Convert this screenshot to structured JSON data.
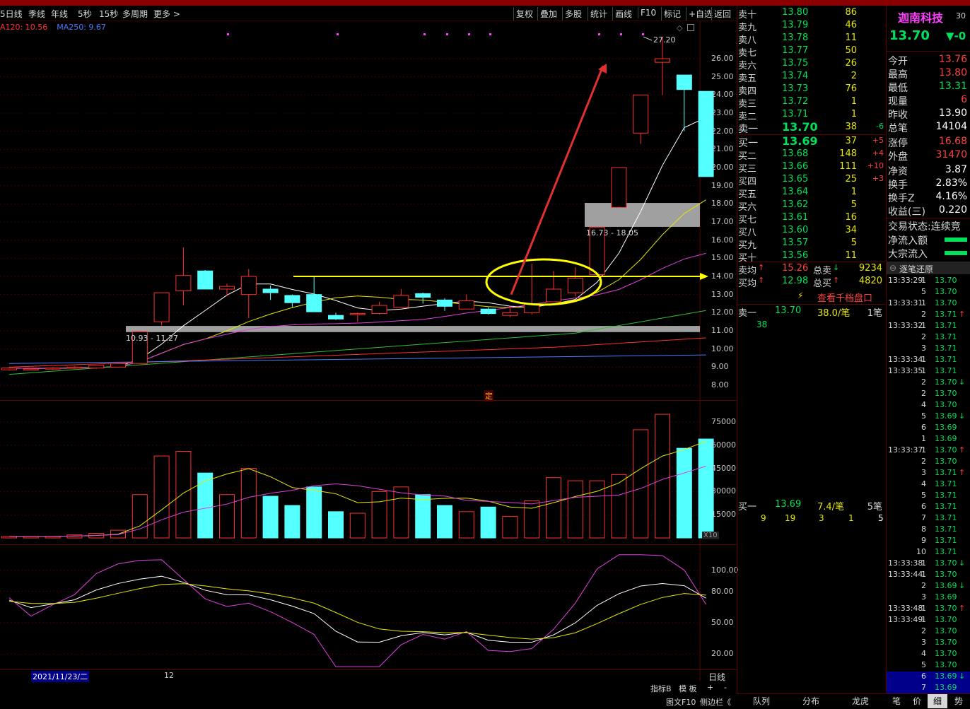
{
  "toolbar": {
    "left_items": [
      "5日线",
      "季线",
      "年线",
      "5秒",
      "15秒",
      "多周期",
      "更多 >"
    ],
    "right_items": [
      "复权",
      "叠加",
      "多股",
      "统计",
      "画线",
      "F10",
      "标记",
      "+自选",
      "返回"
    ]
  },
  "ma_legend": [
    {
      "text": "A120: 10.56",
      "color": "#ff3030"
    },
    {
      "text": "MA250: 9.67",
      "color": "#4a7bff"
    }
  ],
  "price_axis": [
    "26.00",
    "25.00",
    "24.00",
    "23.00",
    "22.00",
    "21.00",
    "20.00",
    "19.00",
    "18.00",
    "17.00",
    "16.00",
    "15.00",
    "14.00",
    "13.00",
    "12.00",
    "11.00",
    "10.00",
    "9.00",
    "8.00"
  ],
  "volume_axis": [
    "75000",
    "60000",
    "45000",
    "30000",
    "15000"
  ],
  "volume_unit": "X10",
  "kdj_axis": [
    "100.00",
    "80.00",
    "50.00",
    "20.00"
  ],
  "annotations": {
    "high_label": "27.20",
    "zone_low_label": "10.93 - 11.27",
    "zone_high_label": "16.73 - 18.05",
    "marker": "定"
  },
  "date_bar": {
    "date": "2021/11/23/二",
    "month": "12",
    "period": "日线"
  },
  "indicator_bar": {
    "items": [
      "指标B",
      "模 板",
      "+",
      "-"
    ]
  },
  "bottom_bar": {
    "items": [
      "图文F10",
      "侧边栏《"
    ]
  },
  "candles": [
    {
      "o": 8.85,
      "c": 8.95,
      "h": 9.0,
      "l": 8.8
    },
    {
      "o": 8.9,
      "c": 8.9,
      "h": 8.95,
      "l": 8.85
    },
    {
      "o": 8.9,
      "c": 8.95,
      "h": 9.0,
      "l": 8.85
    },
    {
      "o": 8.95,
      "c": 9.0,
      "h": 9.05,
      "l": 8.9
    },
    {
      "o": 8.95,
      "c": 9.1,
      "h": 9.1,
      "l": 8.9
    },
    {
      "o": 9.0,
      "c": 9.2,
      "h": 9.2,
      "l": 9.0
    },
    {
      "o": 9.2,
      "c": 10.95,
      "h": 10.95,
      "l": 9.2
    },
    {
      "o": 11.5,
      "c": 13.1,
      "h": 13.1,
      "l": 11.3
    },
    {
      "o": 13.2,
      "c": 14.05,
      "h": 15.6,
      "l": 12.4
    },
    {
      "o": 14.3,
      "c": 13.3,
      "h": 14.35,
      "l": 13.3
    },
    {
      "o": 13.3,
      "c": 13.45,
      "h": 13.6,
      "l": 12.9
    },
    {
      "o": 13.0,
      "c": 14.0,
      "h": 14.4,
      "l": 11.7
    },
    {
      "o": 13.3,
      "c": 13.1,
      "h": 13.5,
      "l": 12.7
    },
    {
      "o": 12.95,
      "c": 12.55,
      "h": 13.0,
      "l": 12.3
    },
    {
      "o": 13.0,
      "c": 12.05,
      "h": 14.0,
      "l": 12.05
    },
    {
      "o": 11.85,
      "c": 11.65,
      "h": 12.0,
      "l": 11.6
    },
    {
      "o": 11.95,
      "c": 11.95,
      "h": 12.0,
      "l": 11.5
    },
    {
      "o": 11.95,
      "c": 12.4,
      "h": 12.6,
      "l": 11.9
    },
    {
      "o": 12.3,
      "c": 12.95,
      "h": 13.3,
      "l": 12.3
    },
    {
      "o": 13.05,
      "c": 12.85,
      "h": 13.1,
      "l": 12.5
    },
    {
      "o": 12.7,
      "c": 12.35,
      "h": 12.8,
      "l": 12.1
    },
    {
      "o": 12.2,
      "c": 12.65,
      "h": 13.0,
      "l": 12.2
    },
    {
      "o": 12.2,
      "c": 11.95,
      "h": 12.3,
      "l": 11.9
    },
    {
      "o": 11.85,
      "c": 12.0,
      "h": 12.35,
      "l": 11.75
    },
    {
      "o": 12.0,
      "c": 12.5,
      "h": 14.7,
      "l": 11.9
    },
    {
      "o": 12.6,
      "c": 13.3,
      "h": 14.3,
      "l": 12.6
    },
    {
      "o": 13.1,
      "c": 13.9,
      "h": 14.5,
      "l": 12.9
    },
    {
      "o": 14.1,
      "c": 16.7,
      "h": 16.7,
      "l": 14.1
    },
    {
      "o": 17.8,
      "c": 20.0,
      "h": 20.0,
      "l": 17.8
    },
    {
      "o": 21.9,
      "c": 24.0,
      "h": 24.0,
      "l": 21.3
    },
    {
      "o": 25.8,
      "c": 26.0,
      "h": 27.2,
      "l": 24.0
    },
    {
      "o": 25.1,
      "c": 24.3,
      "h": 25.1,
      "l": 22.0
    },
    {
      "o": 24.2,
      "c": 19.5,
      "h": 24.2,
      "l": 19.5
    }
  ],
  "volumes": [
    1000,
    1000,
    1000,
    2000,
    3000,
    5000,
    28000,
    53000,
    56000,
    42000,
    28000,
    45000,
    27000,
    21000,
    33000,
    17000,
    16000,
    30000,
    33000,
    28000,
    21000,
    17000,
    20000,
    14000,
    24000,
    39000,
    37000,
    37000,
    41000,
    70000,
    80000,
    58000,
    64000
  ],
  "order_book": {
    "sell": [
      {
        "label": "卖十",
        "price": "13.80",
        "vol": "86",
        "chg": ""
      },
      {
        "label": "卖九",
        "price": "13.79",
        "vol": "46",
        "chg": ""
      },
      {
        "label": "卖八",
        "price": "13.78",
        "vol": "11",
        "chg": ""
      },
      {
        "label": "卖七",
        "price": "13.77",
        "vol": "50",
        "chg": ""
      },
      {
        "label": "卖六",
        "price": "13.75",
        "vol": "26",
        "chg": ""
      },
      {
        "label": "卖五",
        "price": "13.74",
        "vol": "2",
        "chg": ""
      },
      {
        "label": "卖四",
        "price": "13.73",
        "vol": "76",
        "chg": ""
      },
      {
        "label": "卖三",
        "price": "13.72",
        "vol": "1",
        "chg": ""
      },
      {
        "label": "卖二",
        "price": "13.71",
        "vol": "1",
        "chg": ""
      },
      {
        "label": "卖一",
        "price": "13.70",
        "vol": "38",
        "chg": "-6"
      }
    ],
    "buy": [
      {
        "label": "买一",
        "price": "13.69",
        "vol": "37",
        "chg": "+5"
      },
      {
        "label": "买二",
        "price": "13.68",
        "vol": "148",
        "chg": "+4"
      },
      {
        "label": "买三",
        "price": "13.66",
        "vol": "111",
        "chg": "+10"
      },
      {
        "label": "买四",
        "price": "13.65",
        "vol": "25",
        "chg": "+3"
      },
      {
        "label": "买五",
        "price": "13.64",
        "vol": "1",
        "chg": ""
      },
      {
        "label": "买六",
        "price": "13.62",
        "vol": "5",
        "chg": ""
      },
      {
        "label": "买七",
        "price": "13.61",
        "vol": "16",
        "chg": ""
      },
      {
        "label": "买八",
        "price": "13.60",
        "vol": "34",
        "chg": ""
      },
      {
        "label": "买九",
        "price": "13.57",
        "vol": "5",
        "chg": ""
      },
      {
        "label": "买十",
        "price": "13.56",
        "vol": "11",
        "chg": ""
      }
    ],
    "avg_sell_label": "卖均",
    "avg_sell": "15.26",
    "total_sell_label": "总卖",
    "total_sell": "9234",
    "avg_buy_label": "买均",
    "avg_buy": "12.98",
    "total_buy_label": "总买",
    "total_buy": "4820",
    "depth_link": "查看千档盘口",
    "sell1_detail": {
      "label": "卖一",
      "price": "13.70",
      "avg": "38.0/笔",
      "count": "1笔",
      "orders": [
        "38"
      ]
    },
    "buy1_detail": {
      "label": "买一",
      "price": "13.69",
      "avg": "7.4/笔",
      "count": "5笔",
      "orders": [
        "9",
        "19",
        "3",
        "1",
        "5"
      ]
    }
  },
  "quote": {
    "name": "迦南科技",
    "code": "30",
    "price": "13.70",
    "change": "▼-0",
    "rows": [
      {
        "label": "今开",
        "value": "13.76",
        "color": "#ff4040"
      },
      {
        "label": "最高",
        "value": "13.80",
        "color": "#ff4040"
      },
      {
        "label": "最低",
        "value": "13.31",
        "color": "#00e05a"
      },
      {
        "label": "现量",
        "value": "6",
        "color": "#ff4040"
      },
      {
        "label": "昨收",
        "value": "13.90",
        "color": "#ffffff"
      },
      {
        "label": "总笔",
        "value": "14104",
        "color": "#ffffff"
      },
      {
        "label": "涨停",
        "value": "16.68",
        "color": "#ff4040"
      },
      {
        "label": "外盘",
        "value": "31470",
        "color": "#ff4040"
      },
      {
        "label": "净资",
        "value": "3.87",
        "color": "#ffffff"
      },
      {
        "label": "换手",
        "value": "2.83%",
        "color": "#ffffff"
      },
      {
        "label": "换手Z",
        "value": "4.16%",
        "color": "#ffffff"
      },
      {
        "label": "收益(三)",
        "value": "0.220",
        "color": "#ffffff"
      }
    ],
    "trade_status_label": "交易状态:",
    "trade_status": "连续竞",
    "net_inflow": "净流入额",
    "block_inflow": "大宗流入",
    "tick_toggle": "逐笔还原"
  },
  "ticks": [
    {
      "t": "13:33:29",
      "v": "1",
      "p": "13.70",
      "d": ""
    },
    {
      "t": "",
      "v": "5",
      "p": "13.70",
      "d": ""
    },
    {
      "t": "13:33:31",
      "v": "1",
      "p": "13.70",
      "d": ""
    },
    {
      "t": "",
      "v": "2",
      "p": "13.71",
      "d": "↑"
    },
    {
      "t": "13:33:32",
      "v": "1",
      "p": "13.71",
      "d": ""
    },
    {
      "t": "",
      "v": "2",
      "p": "13.71",
      "d": ""
    },
    {
      "t": "",
      "v": "3",
      "p": "13.71",
      "d": ""
    },
    {
      "t": "13:33:34",
      "v": "1",
      "p": "13.71",
      "d": ""
    },
    {
      "t": "13:33:35",
      "v": "1",
      "p": "13.71",
      "d": ""
    },
    {
      "t": "",
      "v": "2",
      "p": "13.70",
      "d": "↓"
    },
    {
      "t": "",
      "v": "2",
      "p": "13.70",
      "d": ""
    },
    {
      "t": "",
      "v": "4",
      "p": "13.70",
      "d": ""
    },
    {
      "t": "",
      "v": "5",
      "p": "13.69",
      "d": "↓"
    },
    {
      "t": "",
      "v": "6",
      "p": "13.69",
      "d": ""
    },
    {
      "t": "",
      "v": "1",
      "p": "13.69",
      "d": ""
    },
    {
      "t": "13:33:37",
      "v": "1",
      "p": "13.70",
      "d": "↑"
    },
    {
      "t": "",
      "v": "2",
      "p": "13.70",
      "d": ""
    },
    {
      "t": "",
      "v": "3",
      "p": "13.71",
      "d": "↑"
    },
    {
      "t": "",
      "v": "4",
      "p": "13.71",
      "d": ""
    },
    {
      "t": "",
      "v": "5",
      "p": "13.71",
      "d": ""
    },
    {
      "t": "",
      "v": "6",
      "p": "13.71",
      "d": ""
    },
    {
      "t": "",
      "v": "7",
      "p": "13.71",
      "d": ""
    },
    {
      "t": "",
      "v": "8",
      "p": "13.71",
      "d": ""
    },
    {
      "t": "",
      "v": "9",
      "p": "13.71",
      "d": ""
    },
    {
      "t": "",
      "v": "10",
      "p": "13.71",
      "d": ""
    },
    {
      "t": "13:33:38",
      "v": "1",
      "p": "13.70",
      "d": "↓"
    },
    {
      "t": "13:33:44",
      "v": "1",
      "p": "13.70",
      "d": ""
    },
    {
      "t": "",
      "v": "2",
      "p": "13.69",
      "d": "↓"
    },
    {
      "t": "",
      "v": "3",
      "p": "13.69",
      "d": ""
    },
    {
      "t": "13:33:48",
      "v": "1",
      "p": "13.70",
      "d": "↑"
    },
    {
      "t": "13:33:49",
      "v": "1",
      "p": "13.70",
      "d": ""
    },
    {
      "t": "",
      "v": "2",
      "p": "13.70",
      "d": ""
    },
    {
      "t": "",
      "v": "3",
      "p": "13.70",
      "d": ""
    },
    {
      "t": "",
      "v": "4",
      "p": "13.70",
      "d": ""
    },
    {
      "t": "",
      "v": "5",
      "p": "13.70",
      "d": ""
    },
    {
      "t": "",
      "v": "6",
      "p": "13.69",
      "d": "↓"
    },
    {
      "t": "",
      "v": "7",
      "p": "13.69",
      "d": ""
    }
  ],
  "bottom_tabs": [
    "队列",
    "分布",
    "龙虎",
    "笔",
    "价",
    "细",
    "势"
  ],
  "colors": {
    "up": "#ff3030",
    "down": "#54ffff",
    "price_up": "#ff4040",
    "price_down": "#00e05a",
    "ma5": "#ffffff",
    "ma10": "#e6e600",
    "ma20": "#e040e0",
    "ma60": "#30c030",
    "ma120": "#ff3030",
    "ma250": "#4a7bff",
    "highlight": "#ffff00"
  }
}
